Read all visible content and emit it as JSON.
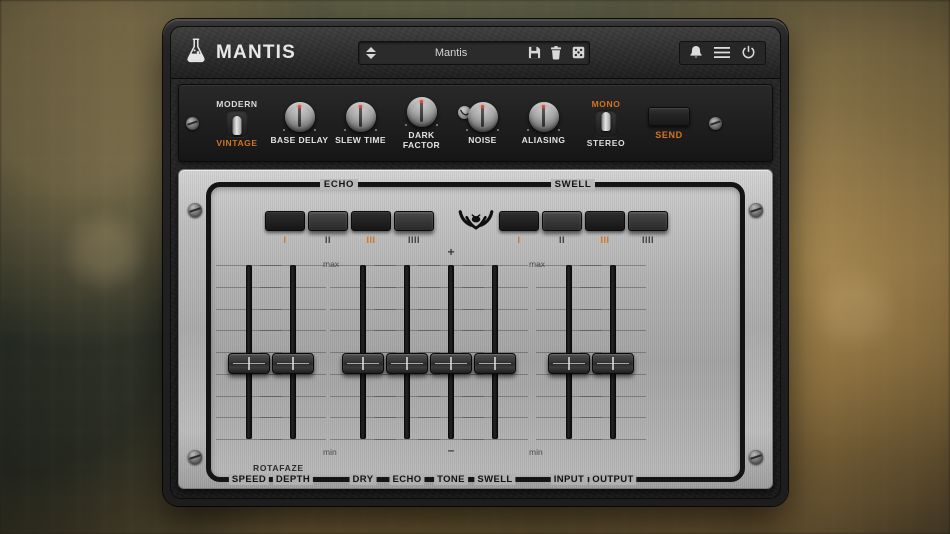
{
  "window": {
    "brand_title": "MANTIS",
    "logo_icon": "flask-icon"
  },
  "preset": {
    "name": "Mantis",
    "prev_icon": "chevron-up-icon",
    "next_icon": "chevron-down-icon",
    "save_icon": "floppy-disk-icon",
    "delete_icon": "trash-icon",
    "random_icon": "dice-icon"
  },
  "header_icons": {
    "notifications": "bell-icon",
    "menu": "hamburger-menu-icon",
    "power": "power-icon"
  },
  "knob_row": {
    "mode_switch": {
      "name": "mode-switch",
      "top_label": "MODERN",
      "bottom_label": "VINTAGE",
      "selected": "VINTAGE"
    },
    "knobs": [
      {
        "label": "BASE DELAY"
      },
      {
        "label": "SLEW TIME"
      },
      {
        "label": "DARK FACTOR"
      },
      {
        "label": "NOISE",
        "badge_icon": "mantis-badge-icon"
      },
      {
        "label": "ALIASING"
      }
    ],
    "routing_switch": {
      "name": "routing-switch",
      "top_label": "MONO",
      "bottom_label": "STEREO",
      "selected": "MONO"
    },
    "send": {
      "label": "SEND",
      "active": false
    }
  },
  "panel": {
    "center_logo_icon": "mantis-logo-icon",
    "sections": [
      {
        "caption": "ECHO",
        "steps": [
          {
            "mark": "I",
            "active": true,
            "pressed": false
          },
          {
            "mark": "II",
            "active": false,
            "pressed": true
          },
          {
            "mark": "III",
            "active": true,
            "pressed": false
          },
          {
            "mark": "IIII",
            "active": false,
            "pressed": true
          }
        ]
      },
      {
        "caption": "SWELL",
        "steps": [
          {
            "mark": "I",
            "active": true,
            "pressed": false
          },
          {
            "mark": "II",
            "active": false,
            "pressed": true
          },
          {
            "mark": "III",
            "active": true,
            "pressed": false
          },
          {
            "mark": "IIII",
            "active": false,
            "pressed": true
          }
        ]
      }
    ],
    "group_label": "ROTAFAZE",
    "scale_max": "max",
    "scale_min": "min",
    "bipolar_plus": "+",
    "bipolar_minus": "–",
    "faders": [
      {
        "label": "SPEED",
        "scale": "unipolar",
        "value_pct": 52
      },
      {
        "label": "DEPTH",
        "scale": "unipolar",
        "value_pct": 52
      },
      {
        "label": "DRY",
        "scale": "unipolar",
        "value_pct": 52
      },
      {
        "label": "ECHO",
        "scale": "unipolar",
        "value_pct": 52
      },
      {
        "label": "TONE",
        "scale": "bipolar",
        "value_pct": 52
      },
      {
        "label": "SWELL",
        "scale": "unipolar",
        "value_pct": 52
      },
      {
        "label": "INPUT",
        "scale": "unipolar",
        "value_pct": 52
      },
      {
        "label": "OUTPUT",
        "scale": "unipolar",
        "value_pct": 52
      }
    ]
  },
  "colors": {
    "accent_orange": "#d4731f",
    "panel_metal": "#b2b2b2",
    "chassis_black": "#1f1f1f",
    "knob_led_red": "#e2443a"
  }
}
